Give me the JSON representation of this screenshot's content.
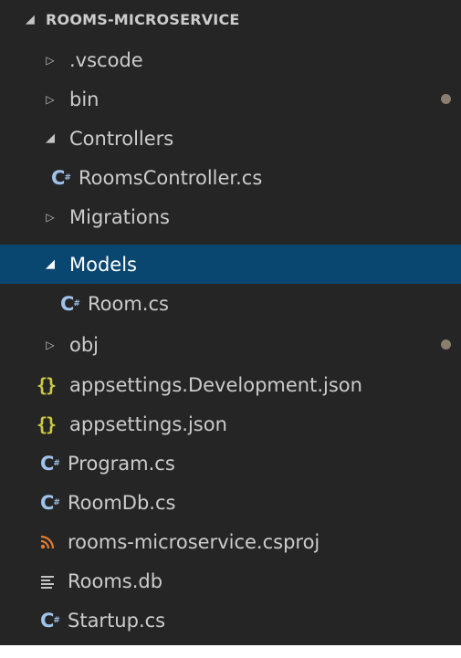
{
  "explorer": {
    "project": "ROOMS-MICROSERVICE",
    "items": [
      {
        "label": ".vscode",
        "kind": "folder",
        "expanded": false
      },
      {
        "label": "bin",
        "kind": "folder",
        "expanded": false,
        "modified": true
      },
      {
        "label": "Controllers",
        "kind": "folder",
        "expanded": true
      },
      {
        "label": "RoomsController.cs",
        "kind": "csharp"
      },
      {
        "label": "Migrations",
        "kind": "folder",
        "expanded": false
      },
      {
        "label": "Models",
        "kind": "folder",
        "expanded": true,
        "selected": true
      },
      {
        "label": "Room.cs",
        "kind": "csharp"
      },
      {
        "label": "obj",
        "kind": "folder",
        "expanded": false,
        "modified": true
      },
      {
        "label": "appsettings.Development.json",
        "kind": "json"
      },
      {
        "label": "appsettings.json",
        "kind": "json"
      },
      {
        "label": "Program.cs",
        "kind": "csharp"
      },
      {
        "label": "RoomDb.cs",
        "kind": "csharp"
      },
      {
        "label": "rooms-microservice.csproj",
        "kind": "csproj"
      },
      {
        "label": "Rooms.db",
        "kind": "db"
      },
      {
        "label": "Startup.cs",
        "kind": "csharp"
      }
    ]
  },
  "icons": {
    "expanded": "chevron-down-icon",
    "collapsed": "chevron-right-icon",
    "csharp": "csharp-file-icon",
    "json": "json-file-icon",
    "csproj": "rss-icon",
    "db": "lines-icon"
  },
  "colors": {
    "background": "#252526",
    "selected": "#094771",
    "text": "#cccccc",
    "csharp": "#9fc3ea",
    "json": "#cbcb41",
    "csproj": "#e37933",
    "modified_dot": "#8a7f6e"
  }
}
